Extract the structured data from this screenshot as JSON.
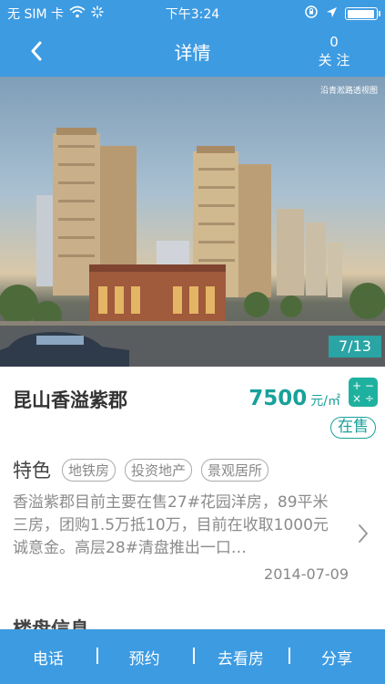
{
  "status_bar": {
    "carrier": "无 SIM 卡",
    "time": "下午3:24",
    "icons": [
      "wifi-icon",
      "activity-spinner-icon",
      "rotation-lock-icon",
      "location-arrow-icon",
      "battery-icon"
    ],
    "battery_level": 0.95
  },
  "nav": {
    "title": "详情",
    "follow_count": "0",
    "follow_label": "关 注",
    "back_icon": "chevron-left-icon"
  },
  "hero": {
    "caption": "沿青淞路透视图",
    "counter": "7/13"
  },
  "listing": {
    "name": "昆山香溢紫郡",
    "price": "7500",
    "price_unit": "元/㎡",
    "calculator_icon": "calculator-icon",
    "status": "在售"
  },
  "features": {
    "title": "特色",
    "tags": [
      "地铁房",
      "投资地产",
      "景观居所"
    ]
  },
  "news": {
    "text": "香溢紫郡目前主要在售27#花园洋房，89平米三房，团购1.5万抵10万，目前在收取1000元诚意金。高层28#清盘推出一口…",
    "date": "2014-07-09"
  },
  "next_section": {
    "title": "楼盘信息"
  },
  "bottom_tabs": [
    "电话",
    "预约",
    "去看房",
    "分享"
  ],
  "colors": {
    "primary": "#3d9be2",
    "accent": "#19a19a"
  }
}
